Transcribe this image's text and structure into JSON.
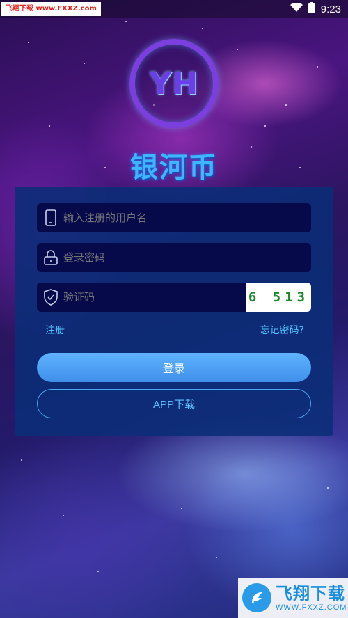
{
  "status_bar": {
    "watermark": "飞翔下载 www.FXXZ.com",
    "time": "9:23"
  },
  "logo": {
    "emblem_text": "YH",
    "name": "银河币"
  },
  "login_form": {
    "username_placeholder": "输入注册的用户名",
    "password_placeholder": "登录密码",
    "captcha_placeholder": "验证码",
    "captcha_code": "6 513",
    "register_link": "注册",
    "forgot_link": "忘记密码?",
    "login_button": "登录",
    "app_download_button": "APP下载"
  },
  "bottom_watermark": {
    "title": "飞翔下载",
    "url": "WWW.FXXZ.COM"
  },
  "colors": {
    "card": "#0a2d78",
    "field": "#06094a",
    "accent": "#55c6ff",
    "login_button": "#4a9cf2"
  },
  "icons": {
    "username": "phone-icon",
    "password": "lock-icon",
    "captcha": "shield-check-icon",
    "status_wifi": "wifi-icon",
    "status_battery": "battery-icon"
  }
}
